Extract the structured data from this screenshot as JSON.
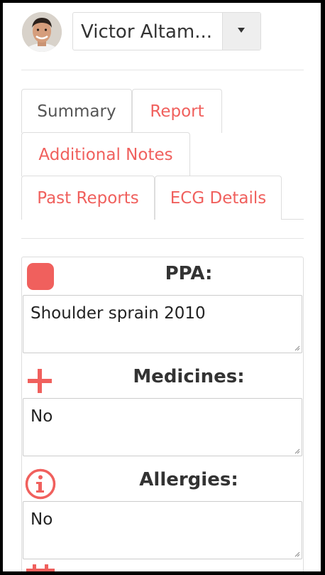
{
  "header": {
    "user_name": "Victor Altam...",
    "avatar_icon": "user-avatar",
    "dropdown_icon": "caret-down-icon"
  },
  "tabs": [
    {
      "label": "Summary",
      "active": true
    },
    {
      "label": "Report",
      "active": false
    },
    {
      "label": "Additional Notes",
      "active": false
    },
    {
      "label": "Past Reports",
      "active": false
    },
    {
      "label": "ECG Details",
      "active": false
    }
  ],
  "sections": [
    {
      "title": "PPA:",
      "icon": "stop-square-icon",
      "value": "Shoulder sprain 2010"
    },
    {
      "title": "Medicines:",
      "icon": "plus-icon",
      "value": "No"
    },
    {
      "title": "Allergies:",
      "icon": "info-circle-icon",
      "value": "No"
    }
  ],
  "colors": {
    "accent": "#f0605d",
    "text": "#333333",
    "border": "#dddddd"
  }
}
